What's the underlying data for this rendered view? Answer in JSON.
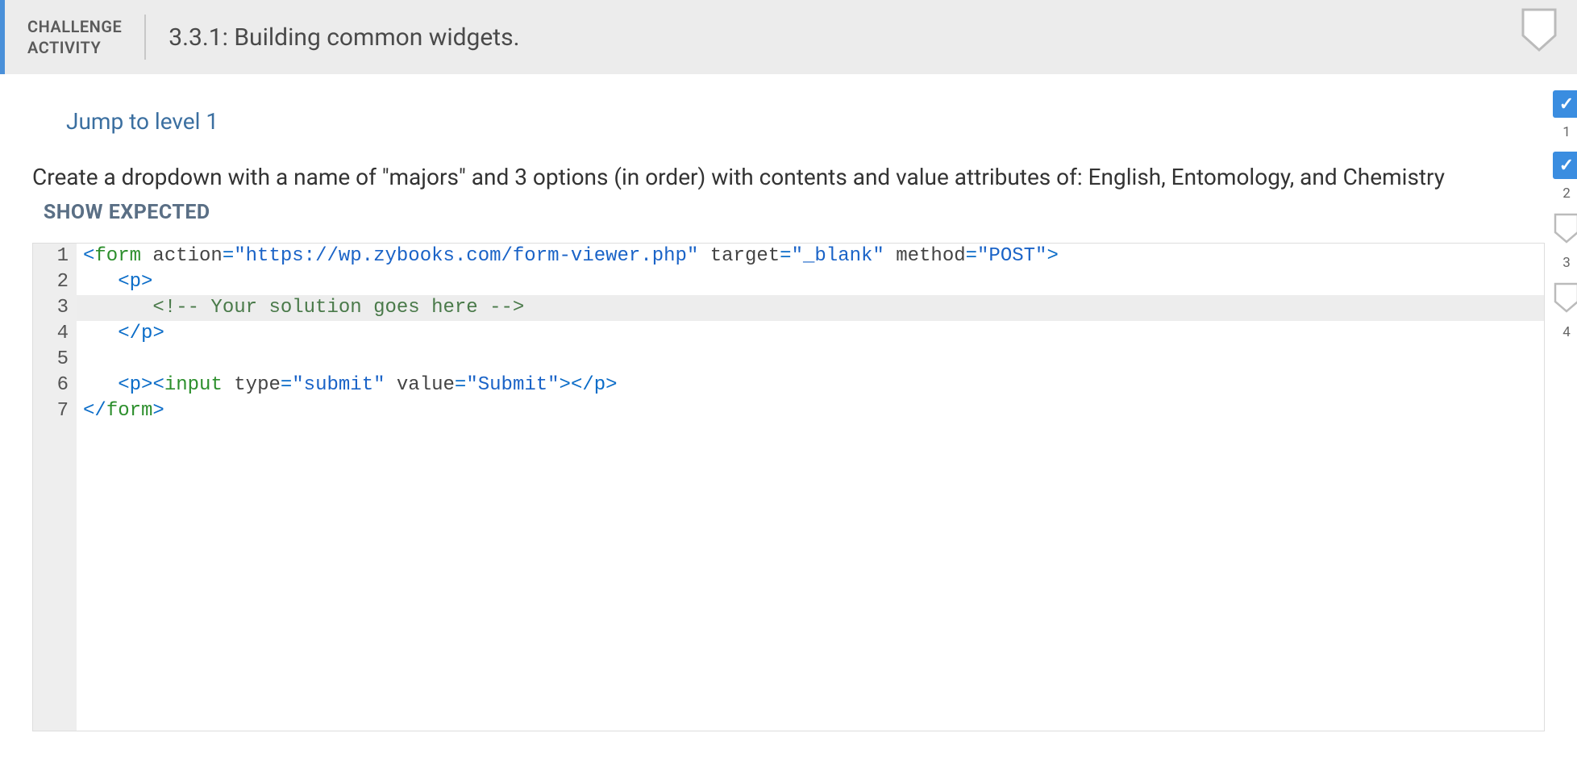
{
  "header": {
    "label_line1": "CHALLENGE",
    "label_line2": "ACTIVITY",
    "title": "3.3.1: Building common widgets."
  },
  "jump_link": "Jump to level 1",
  "prompt_text": "Create a dropdown with a name of \"majors\" and 3 options (in order) with contents and value attributes of: English, Entomology, and Chemistry",
  "show_expected": "SHOW EXPECTED",
  "code": {
    "l1": {
      "num": "1",
      "form_open": "<",
      "tag": "form",
      "sp1": " ",
      "a1": "action",
      "eq": "=",
      "v1": "\"https://wp.zybooks.com/form-viewer.php\"",
      "sp2": " ",
      "a2": "target",
      "v2": "\"_blank\"",
      "sp3": " ",
      "a3": "method",
      "v3": "\"POST\"",
      "close": ">"
    },
    "l2": {
      "num": "2",
      "indent": "   ",
      "open": "<",
      "tag": "p",
      "close": ">"
    },
    "l3": {
      "num": "3",
      "indent": "      ",
      "cmt": "<!-- Your solution goes here -->"
    },
    "l4": {
      "num": "4",
      "indent": "   ",
      "open": "</",
      "tag": "p",
      "close": ">"
    },
    "l5": {
      "num": "5",
      "blank": ""
    },
    "l6": {
      "num": "6",
      "indent": "   ",
      "o1": "<",
      "t1": "p",
      "c1": ">",
      "o2": "<",
      "t2": "input",
      "sp1": " ",
      "a1": "type",
      "eq": "=",
      "v1": "\"submit\"",
      "sp2": " ",
      "a2": "value",
      "v2": "\"Submit\"",
      "c2": ">",
      "o3": "</",
      "t3": "p",
      "c3": ">"
    },
    "l7": {
      "num": "7",
      "open": "</",
      "tag": "form",
      "close": ">"
    }
  },
  "levels": [
    {
      "num": "1",
      "done": true
    },
    {
      "num": "2",
      "done": true
    },
    {
      "num": "3",
      "done": false
    },
    {
      "num": "4",
      "done": false
    }
  ]
}
